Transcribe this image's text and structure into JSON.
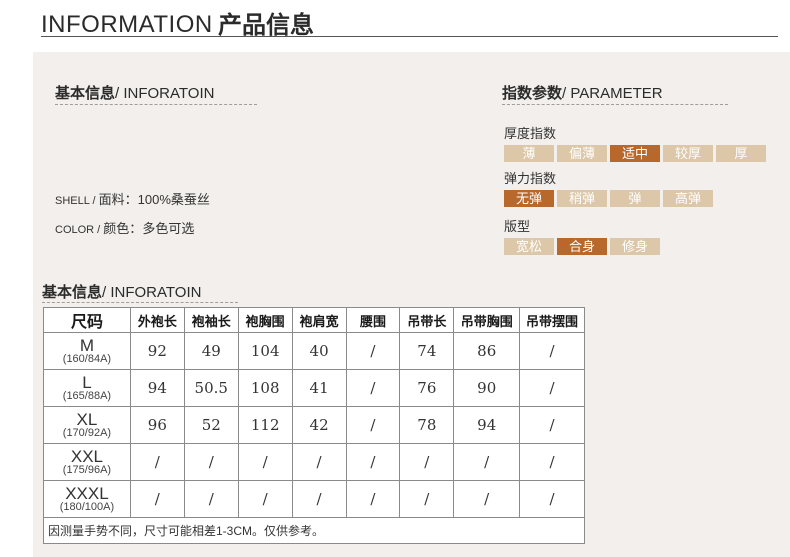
{
  "header": {
    "title_en": "INFORMATION",
    "title_cn": "产品信息"
  },
  "basic": {
    "title_cn": "基本信息",
    "title_en": "/ INFORATOIN",
    "shell_prefix": "SHELL / ",
    "shell_label": "面料：",
    "shell_value": "100%桑蚕丝",
    "color_prefix": "COLOR / ",
    "color_label": "颜色：",
    "color_value": "多色可选"
  },
  "parameter": {
    "title_cn": "指数参数",
    "title_en": "/ PARAMETER",
    "groups": [
      {
        "label": "厚度指数",
        "options": [
          "薄",
          "偏薄",
          "适中",
          "较厚",
          "厚"
        ],
        "selected": "适中"
      },
      {
        "label": "弹力指数",
        "options": [
          "无弹",
          "稍弹",
          "弹",
          "高弹"
        ],
        "selected": "无弹"
      },
      {
        "label": "版型",
        "options": [
          "宽松",
          "合身",
          "修身"
        ],
        "selected": "合身"
      }
    ]
  },
  "size_table": {
    "title_cn": "基本信息",
    "title_en": "/ INFORATOIN",
    "headers": [
      "尺码",
      "外袍长",
      "袍袖长",
      "袍胸围",
      "袍肩宽",
      "腰围",
      "吊带长",
      "吊带胸围",
      "吊带摆围"
    ],
    "rows": [
      {
        "size": "M",
        "sub": "(160/84A)",
        "values": [
          "92",
          "49",
          "104",
          "40",
          "/",
          "74",
          "86",
          "/"
        ]
      },
      {
        "size": "L",
        "sub": "(165/88A)",
        "values": [
          "94",
          "50.5",
          "108",
          "41",
          "/",
          "76",
          "90",
          "/"
        ]
      },
      {
        "size": "XL",
        "sub": "(170/92A)",
        "values": [
          "96",
          "52",
          "112",
          "42",
          "/",
          "78",
          "94",
          "/"
        ]
      },
      {
        "size": "XXL",
        "sub": "(175/96A)",
        "values": [
          "/",
          "/",
          "/",
          "/",
          "/",
          "/",
          "/",
          "/"
        ]
      },
      {
        "size": "XXXL",
        "sub": "(180/100A)",
        "values": [
          "/",
          "/",
          "/",
          "/",
          "/",
          "/",
          "/",
          "/"
        ]
      }
    ],
    "note": "因测量手势不同，尺寸可能相差1-3CM。仅供参考。"
  },
  "colors": {
    "chip_active": "#b9682c",
    "chip_inactive": "#dcc7a8",
    "panel_bg": "#f2efec"
  }
}
